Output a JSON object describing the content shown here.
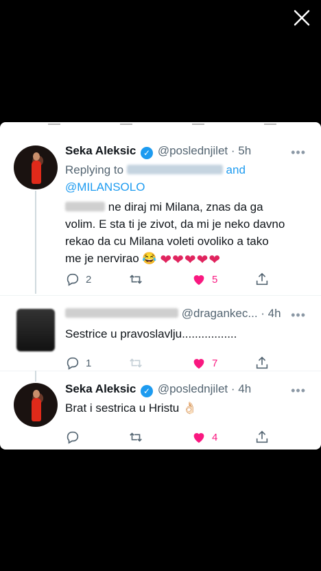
{
  "close_label": "×",
  "tweets": [
    {
      "name": "Seka Aleksic",
      "handle": "@poslednjilet",
      "time": "· 5h",
      "replying_to": "Replying to",
      "and": "and",
      "mention": "@MILANSOLO",
      "text_line1": "ne diraj mi Milana, znas da ga",
      "text_line2": "volim. E sta ti je zivot, da mi je neko davno",
      "text_line3": "rekao da cu Milana voleti ovoliko a tako",
      "text_line4": "me je nervirao 😂",
      "replies": "2",
      "retweets": "",
      "likes": "5"
    },
    {
      "handle": "@dragankec...",
      "time": "· 4h",
      "text": "Sestrice u pravoslavlju.................",
      "replies": "1",
      "likes": "7"
    },
    {
      "name": "Seka Aleksic",
      "handle": "@poslednjilet",
      "time": "· 4h",
      "text": "Brat i sestrica u Hristu 👌🏻",
      "replies": "",
      "likes": "4"
    }
  ],
  "more_label": "•••",
  "colors": {
    "link": "#1d9bf0",
    "heart": "#f91880",
    "muted": "#536471"
  }
}
